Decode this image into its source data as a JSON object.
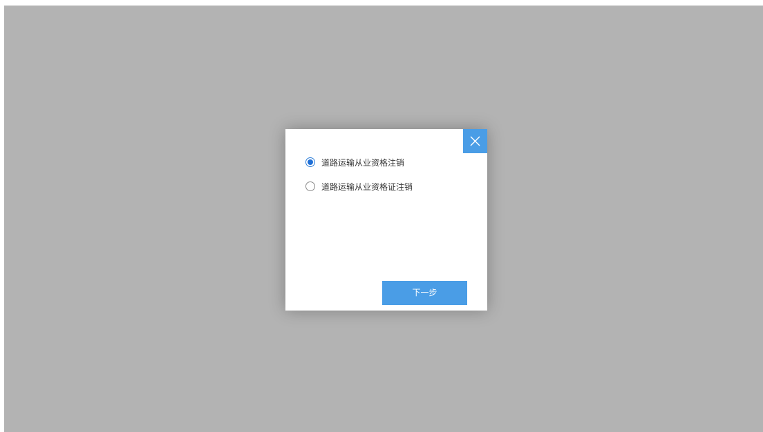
{
  "dialog": {
    "options": [
      {
        "label": "道路运输从业资格注销",
        "selected": true
      },
      {
        "label": "道路运输从业资格证注销",
        "selected": false
      }
    ],
    "next_label": "下一步",
    "close_icon": "close-icon"
  },
  "colors": {
    "overlay": "#b3b3b3",
    "accent": "#4a9de6",
    "radio_selected": "#1f6fd6"
  }
}
